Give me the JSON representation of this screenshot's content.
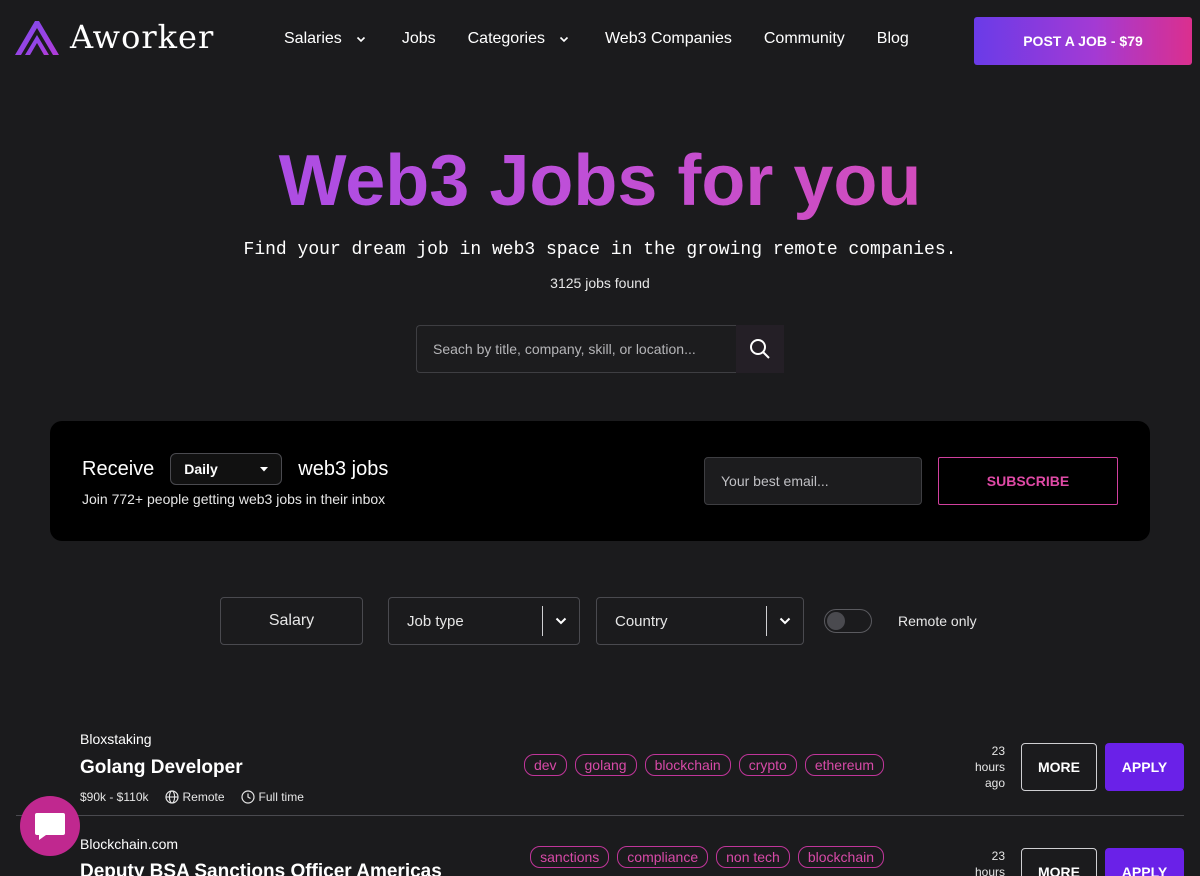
{
  "brand": {
    "name": "Aworker",
    "accent": "#6a21e8",
    "pink": "#e04aa6"
  },
  "nav": {
    "items": [
      {
        "label": "Salaries",
        "has_dropdown": true
      },
      {
        "label": "Jobs",
        "has_dropdown": false
      },
      {
        "label": "Categories",
        "has_dropdown": true
      },
      {
        "label": "Web3 Companies",
        "has_dropdown": false
      },
      {
        "label": "Community",
        "has_dropdown": false
      },
      {
        "label": "Blog",
        "has_dropdown": false
      }
    ],
    "post_job_label": "POST A JOB - $79"
  },
  "hero": {
    "title": "Web3 Jobs for you",
    "subtitle": "Find your dream job in web3 space in the growing remote companies.",
    "jobs_found": "3125 jobs found",
    "search_placeholder": "Seach by title, company, skill, or location..."
  },
  "subscribe": {
    "receive_label": "Receive",
    "frequency": "Daily",
    "suffix_label": "web3 jobs",
    "join_text": "Join 772+ people getting web3 jobs in their inbox",
    "email_placeholder": "Your best email...",
    "button_label": "SUBSCRIBE"
  },
  "filters": {
    "salary_label": "Salary",
    "job_type_label": "Job type",
    "country_label": "Country",
    "remote_only_label": "Remote only",
    "remote_only_on": false
  },
  "jobs": [
    {
      "company": "Bloxstaking",
      "title": "Golang Developer",
      "salary": "$90k - $110k",
      "location": "Remote",
      "type": "Full time",
      "tags": [
        "dev",
        "golang",
        "blockchain",
        "crypto",
        "ethereum"
      ],
      "posted_lines": [
        "23",
        "hours",
        "ago"
      ],
      "more_label": "MORE",
      "apply_label": "APPLY"
    },
    {
      "company": "Blockchain.com",
      "title": "Deputy BSA Sanctions Officer Americas",
      "tags": [
        "sanctions",
        "compliance",
        "non tech",
        "blockchain"
      ],
      "posted_lines": [
        "23",
        "hours"
      ],
      "more_label": "MORE",
      "apply_label": "APPLY"
    }
  ]
}
